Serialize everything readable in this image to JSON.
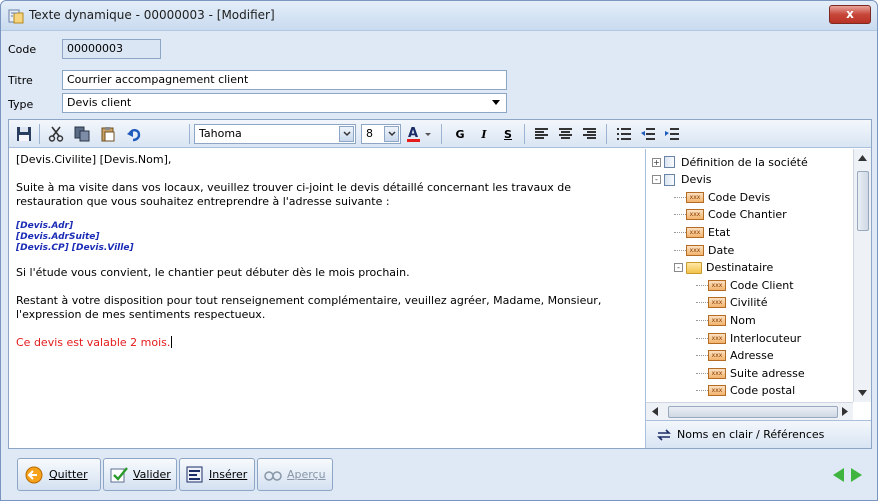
{
  "window": {
    "title": "Texte dynamique - 00000003 - [Modifier]",
    "close_label": "x"
  },
  "form": {
    "code_label": "Code",
    "code_value": "00000003",
    "titre_label": "Titre",
    "titre_value": "Courrier accompagnement client",
    "type_label": "Type",
    "type_value": "Devis client"
  },
  "toolbar": {
    "font_name": "Tahoma",
    "font_size": "8",
    "bold_label": "G",
    "italic_label": "I",
    "underline_label": "S",
    "icons": [
      "save-icon",
      "cut-icon",
      "copy-icon",
      "paste-icon",
      "undo-icon",
      "font-color-icon",
      "align-left-icon",
      "align-center-icon",
      "align-right-icon",
      "bullets-icon",
      "outdent-icon",
      "indent-icon"
    ]
  },
  "editor": {
    "line1": "[Devis.Civilite] [Devis.Nom],",
    "para1": "Suite à ma visite dans vos locaux, veuillez trouver ci-joint le devis détaillé concernant  les travaux de restauration que vous souhaitez entreprendre à l'adresse suivante :",
    "merge1": "[Devis.Adr]",
    "merge2": "[Devis.AdrSuite]",
    "merge3": "[Devis.CP] [Devis.Ville]",
    "para2": "Si l'étude vous convient, le chantier peut débuter dès le mois prochain.",
    "para3": "Restant à votre disposition pour tout renseignement complémentaire, veuillez agréer, Madame, Monsieur, l'expression de mes sentiments respectueux.",
    "red_line": "Ce devis est valable 2 mois.",
    "red_color": "#e41c1c"
  },
  "tree": {
    "items": [
      {
        "label": "Définition de la société",
        "level": 0,
        "kind": "book",
        "expander": "+"
      },
      {
        "label": "Devis",
        "level": 0,
        "kind": "book",
        "expander": "-"
      },
      {
        "label": "Code Devis",
        "level": 1,
        "kind": "field"
      },
      {
        "label": "Code Chantier",
        "level": 1,
        "kind": "field"
      },
      {
        "label": "Etat",
        "level": 1,
        "kind": "field"
      },
      {
        "label": "Date",
        "level": 1,
        "kind": "field"
      },
      {
        "label": "Destinataire",
        "level": 1,
        "kind": "folder",
        "expander": "-"
      },
      {
        "label": "Code Client",
        "level": 2,
        "kind": "field"
      },
      {
        "label": "Civilité",
        "level": 2,
        "kind": "field"
      },
      {
        "label": "Nom",
        "level": 2,
        "kind": "field"
      },
      {
        "label": "Interlocuteur",
        "level": 2,
        "kind": "field"
      },
      {
        "label": "Adresse",
        "level": 2,
        "kind": "field"
      },
      {
        "label": "Suite adresse",
        "level": 2,
        "kind": "field"
      },
      {
        "label": "Code postal",
        "level": 2,
        "kind": "field"
      }
    ],
    "field_icon_text": "xxx",
    "toggle_label": "Noms en clair / Références"
  },
  "buttons": {
    "quitter": "Quitter",
    "valider": "Valider",
    "inserer": "Insérer",
    "apercu": "Aperçu"
  }
}
